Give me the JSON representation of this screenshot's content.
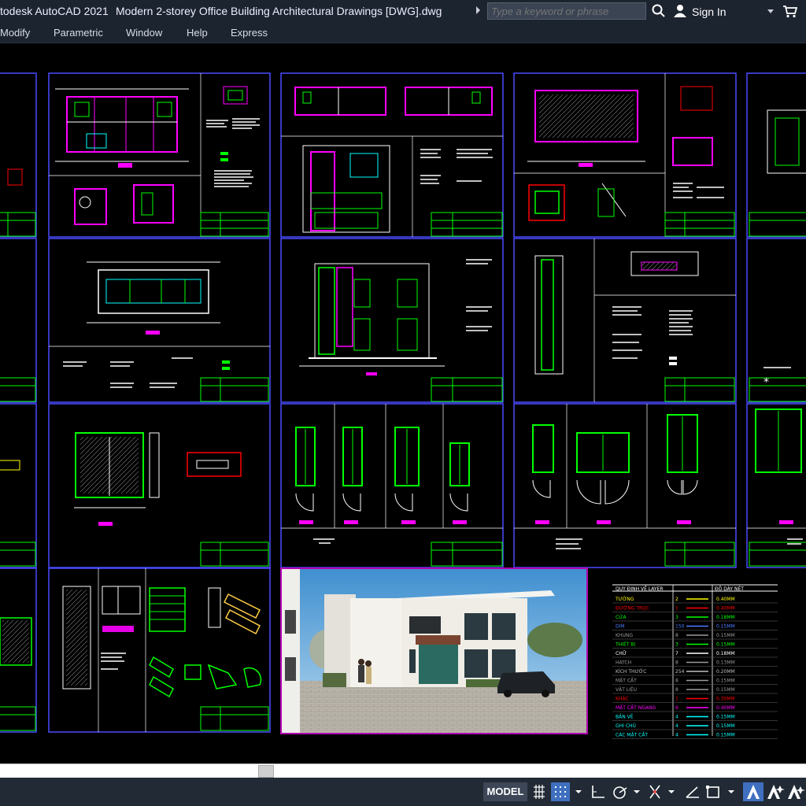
{
  "window": {
    "app_title": "todesk AutoCAD 2021",
    "document_title": "Modern 2-storey Office Building Architectural Drawings [DWG].dwg"
  },
  "search": {
    "placeholder": "Type a keyword or phrase"
  },
  "account": {
    "sign_in_label": "Sign In"
  },
  "menu": {
    "items": [
      "Modify",
      "Parametric",
      "Window",
      "Help",
      "Express"
    ]
  },
  "status_bar": {
    "space_label": "MODEL",
    "icons": [
      "grid-icon",
      "snap-icon",
      "ortho-icon",
      "polar-icon",
      "osnap-icon",
      "dynamic-ucs-icon",
      "selection-cycling-icon",
      "annotation-scale-icon",
      "workspace-icon"
    ]
  },
  "drawing": {
    "sheet_border_color": "#4b4bff",
    "line_colors": [
      "#00ff00",
      "#ff00ff",
      "#ffffff",
      "#ff0000",
      "#00ffff",
      "#ffff00"
    ],
    "rendering_caption": "",
    "layer_table": {
      "header_left": "QUY ĐỊNH VỀ LAYER",
      "header_right": "ĐỘ DÀY NÉT",
      "rows": [
        {
          "name": "TƯỜNG",
          "num": "2",
          "weight": "0.40MM",
          "color": "#ffff00"
        },
        {
          "name": "ĐƯỜNG TRỤC",
          "num": "1",
          "weight": "0.40MM",
          "color": "#ff0000"
        },
        {
          "name": "CỬA",
          "num": "3",
          "weight": "0.18MM",
          "color": "#00ff00"
        },
        {
          "name": "DIM",
          "num": "150",
          "weight": "0.15MM",
          "color": "#4d7cff"
        },
        {
          "name": "KHUNG",
          "num": "8",
          "weight": "0.15MM",
          "color": "#9a9a9a"
        },
        {
          "name": "THIẾT BỊ",
          "num": "3",
          "weight": "0.15MM",
          "color": "#00ff00"
        },
        {
          "name": "CHỮ",
          "num": "7",
          "weight": "0.18MM",
          "color": "#ffffff"
        },
        {
          "name": "HATCH",
          "num": "8",
          "weight": "0.13MM",
          "color": "#9a9a9a"
        },
        {
          "name": "KÍCH THƯỚC",
          "num": "254",
          "weight": "0.20MM",
          "color": "#bfbfbf"
        },
        {
          "name": "MẶT CẮT",
          "num": "8",
          "weight": "0.15MM",
          "color": "#9a9a9a"
        },
        {
          "name": "VẬT LIỆU",
          "num": "8",
          "weight": "0.15MM",
          "color": "#9a9a9a"
        },
        {
          "name": "KHÁC",
          "num": "1",
          "weight": "0.30MM",
          "color": "#ff0000"
        },
        {
          "name": "MẶT CẮT NGANG",
          "num": "6",
          "weight": "0.40MM",
          "color": "#ff00ff"
        },
        {
          "name": "BẢN VẼ",
          "num": "4",
          "weight": "0.15MM",
          "color": "#00ffff"
        },
        {
          "name": "GHI CHÚ",
          "num": "4",
          "weight": "0.15MM",
          "color": "#00ffff"
        },
        {
          "name": "CÁC MẶT CẮT",
          "num": "4",
          "weight": "0.15MM",
          "color": "#00ffff"
        }
      ]
    }
  }
}
